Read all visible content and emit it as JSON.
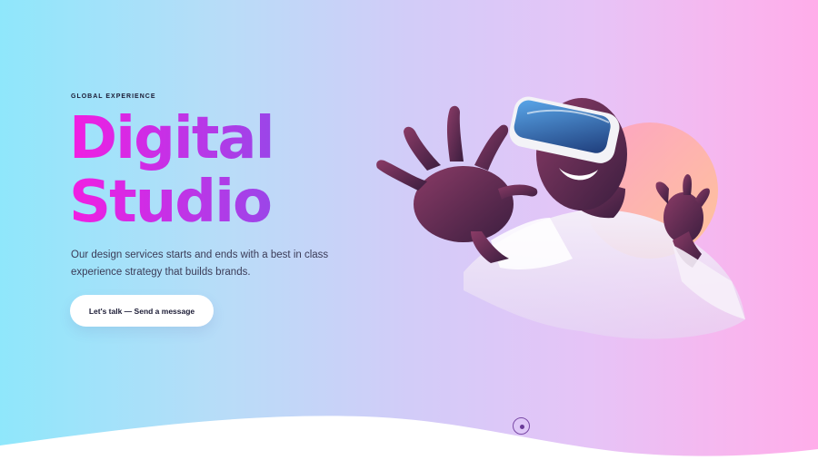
{
  "hero": {
    "eyebrow": "GLOBAL EXPERIENCE",
    "title_line1": "Digital",
    "title_line2": "Studio",
    "description": "Our design services starts and ends with a best in class experience strategy that builds brands.",
    "cta_label": "Let's talk — Send a message"
  },
  "colors": {
    "title_gradient_start": "#f21ee2",
    "title_gradient_end": "#9a46e8",
    "background_left": "#8fe7fb",
    "background_right": "#ffadea",
    "accent_circle": "#ffb59a"
  },
  "icons": {
    "scroll_indicator": "scroll-dot-icon"
  }
}
